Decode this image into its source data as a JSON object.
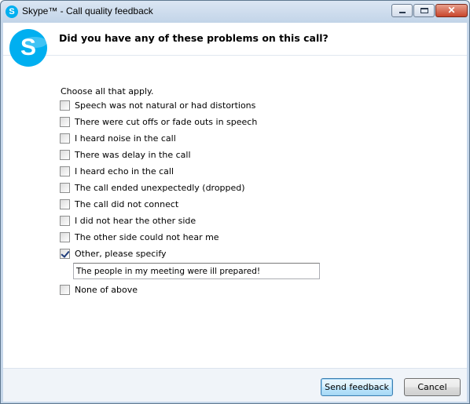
{
  "window": {
    "title": "Skype™ - Call quality feedback",
    "app_icon_letter": "S",
    "close_glyph": "✕"
  },
  "header": {
    "question": "Did you have any of these problems on this call?",
    "logo_letter": "S",
    "brand_color": "#00aff0"
  },
  "instruction": "Choose all that apply.",
  "options": [
    {
      "label": "Speech was not natural or had distortions",
      "checked": false
    },
    {
      "label": "There were cut offs or fade outs in speech",
      "checked": false
    },
    {
      "label": "I heard noise in the call",
      "checked": false
    },
    {
      "label": "There was delay in the call",
      "checked": false
    },
    {
      "label": "I heard echo in the call",
      "checked": false
    },
    {
      "label": "The call ended unexpectedly (dropped)",
      "checked": false
    },
    {
      "label": "The call did not connect",
      "checked": false
    },
    {
      "label": "I did not hear the other side",
      "checked": false
    },
    {
      "label": "The other side could not hear me",
      "checked": false
    },
    {
      "label": "Other, please specify",
      "checked": true
    },
    {
      "label": "None of above",
      "checked": false
    }
  ],
  "other_input": {
    "value": "The people in my meeting were ill prepared!"
  },
  "buttons": {
    "send": "Send feedback",
    "cancel": "Cancel"
  }
}
